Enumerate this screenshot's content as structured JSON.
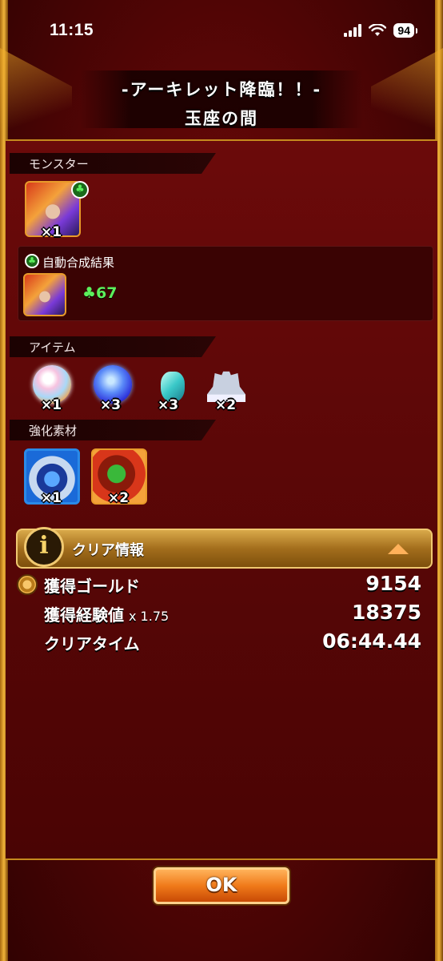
{
  "status_bar": {
    "time": "11:15",
    "battery": "94"
  },
  "title": {
    "line1": "-アーキレット降臨！！-",
    "line2": "玉座の間"
  },
  "sections": {
    "monster": {
      "header": "モンスター",
      "count": "×1",
      "auto_label": "自動合成結果",
      "auto_value": "♣67"
    },
    "items": {
      "header": "アイテム",
      "counts": [
        "×1",
        "×3",
        "×3",
        "×2"
      ]
    },
    "enhance": {
      "header": "強化素材",
      "counts": [
        "×1",
        "×2"
      ]
    }
  },
  "clear_info": {
    "label": "クリア情報",
    "rows": [
      {
        "label": "獲得ゴールド",
        "sub": "",
        "value": "9154"
      },
      {
        "label": "獲得経験値",
        "sub": "x 1.75",
        "value": "18375"
      },
      {
        "label": "クリアタイム",
        "sub": "",
        "value": "06:44.44"
      }
    ]
  },
  "ok_button": "OK",
  "colors": {
    "accent_gold": "#c58a1e",
    "luck_green": "#5cf05c",
    "button_orange": "#f07a1a"
  },
  "icons": [
    "signal-icon",
    "wifi-icon",
    "luck-icon",
    "info-icon",
    "collapse-icon",
    "gold-coin-icon"
  ]
}
